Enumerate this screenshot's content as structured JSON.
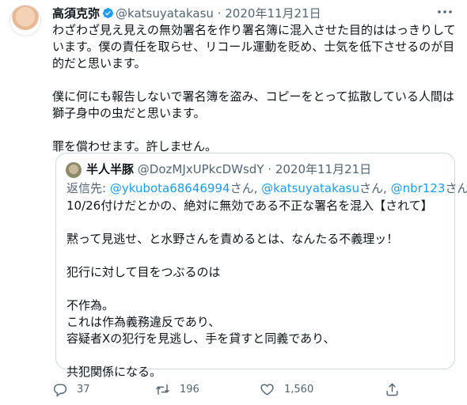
{
  "tweet": {
    "author_name": "高須克弥",
    "handle": "@katsuyatakasu",
    "separator": "·",
    "date": "2020年11月21日",
    "paragraphs": [
      "わざわざ見え見えの無効署名を作り署名簿に混入させた目的ははっきりしています。僕の責任を取らせ、リコール運動を貶め、士気を低下させるのが目的だと思います。",
      "僕に何にも報告しないで署名簿を盗み、コピーをとって拡散している人間は獅子身中の虫だと思います。",
      "罪を償わせます。許しません。"
    ]
  },
  "quote": {
    "author_name": "半人半豚",
    "handle": "@DozMJxUPkcDWsdY",
    "separator": "·",
    "date": "2020年11月21日",
    "reply_prefix": "返信先: ",
    "reply_mention_1": "@ykubota68646994",
    "reply_join_1": "さん, ",
    "reply_mention_2": "@katsuyatakasu",
    "reply_join_2": "さん, ",
    "reply_mention_3": "@nbr123",
    "reply_suffix": "さん",
    "lines": [
      "10/26付けだとかの、絶対に無効である不正な署名を混入【されて】",
      "黙って見逃せ、と水野さんを責めるとは、なんたる不義理ッ！",
      "犯行に対して目をつぶるのは",
      "不作為。",
      "これは作為義務違反であり、",
      "容疑者Xの犯行を見逃し、手を貸すと同義であり、",
      "共犯関係になる。"
    ]
  },
  "actions": {
    "reply_count": "37",
    "retweet_count": "196",
    "like_count": "1,560"
  },
  "icons": {
    "verified": "verified-badge-icon",
    "more": "more-icon",
    "reply": "reply-icon",
    "retweet": "retweet-icon",
    "like": "like-icon",
    "share": "share-icon"
  },
  "colors": {
    "accent": "#1d9bf0",
    "secondary_text": "#536471",
    "border": "#cfd9de"
  }
}
